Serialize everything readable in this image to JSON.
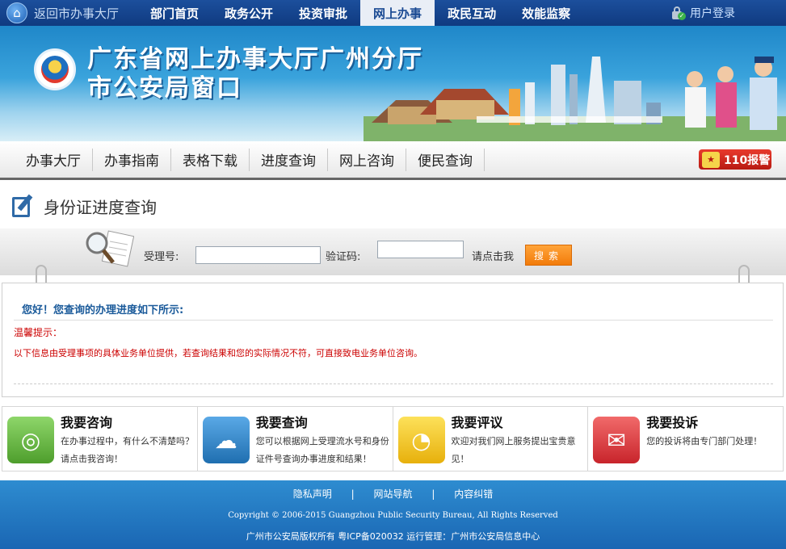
{
  "topnav": {
    "back_label": "返回市办事大厅",
    "items": [
      {
        "label": "部门首页"
      },
      {
        "label": "政务公开"
      },
      {
        "label": "投资审批"
      },
      {
        "label": "网上办事"
      },
      {
        "label": "政民互动"
      },
      {
        "label": "效能监察"
      }
    ],
    "active_index": 3,
    "login_label": "用户登录"
  },
  "banner": {
    "title_line1": "广东省网上办事大厅广州分厅",
    "title_line2": "市公安局窗口"
  },
  "subnav": {
    "items": [
      {
        "label": "办事大厅"
      },
      {
        "label": "办事指南"
      },
      {
        "label": "表格下载"
      },
      {
        "label": "进度查询"
      },
      {
        "label": "网上咨询"
      },
      {
        "label": "便民查询"
      }
    ],
    "alarm_label": "110报警"
  },
  "page": {
    "title": "身份证进度查询"
  },
  "search": {
    "accept_label": "受理号:",
    "accept_value": "",
    "verify_label": "验证码:",
    "verify_value": "",
    "captcha_hint": "请点击我",
    "button_label": "搜索"
  },
  "result": {
    "heading": "您好！您查询的办理进度如下所示:",
    "tip_title": "温馨提示：",
    "tip_text": "以下信息由受理事项的具体业务单位提供，若查询结果和您的实际情况不符，可直接致电业务单位咨询。"
  },
  "services": [
    {
      "title": "我要咨询",
      "desc": "在办事过程中，有什么不清楚吗？请点击我咨询！",
      "icon": "globe-chat-icon",
      "color": "#5cae37"
    },
    {
      "title": "我要查询",
      "desc": "您可以根据网上受理流水号和身份证件号查询办事进度和结果！",
      "icon": "cloud-chat-icon",
      "color": "#2f82c4"
    },
    {
      "title": "我要评议",
      "desc": "欢迎对我们网上服务提出宝贵意见！",
      "icon": "pacman-icon",
      "color": "#f1c21b"
    },
    {
      "title": "我要投诉",
      "desc": "您的投诉将由专门部门处理！",
      "icon": "envelope-icon",
      "color": "#e0373d"
    }
  ],
  "footer": {
    "links": [
      {
        "label": "隐私声明"
      },
      {
        "label": "网站导航"
      },
      {
        "label": "内容纠错"
      }
    ],
    "separator": "|",
    "copyright": "Copyright © 2006-2015 Guangzhou Public Security Bureau, All Rights Reserved",
    "icp": "广州市公安局版权所有 粤ICP备020032 运行管理：广州市公安局信息中心"
  }
}
